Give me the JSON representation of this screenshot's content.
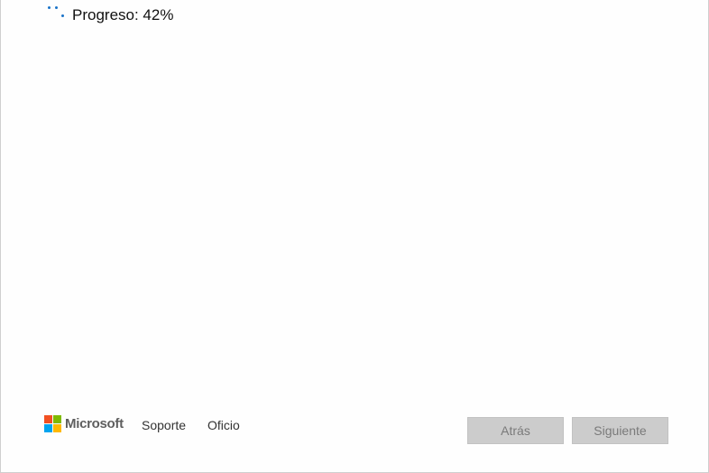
{
  "progress": {
    "label": "Progreso: 42%",
    "value": 0.42,
    "spinner_icon": "loading-spinner-icon"
  },
  "footer": {
    "brand": {
      "name": "Microsoft",
      "icon": "microsoft-logo-icon",
      "colors": [
        "#f25022",
        "#7fba00",
        "#00a4ef",
        "#ffb900"
      ]
    },
    "links": {
      "support": "Soporte",
      "legal": "Oficio"
    },
    "buttons": {
      "back": "Atrás",
      "next": "Siguiente",
      "back_enabled": false,
      "next_enabled": false
    }
  },
  "colors": {
    "accent": "#1a73c8",
    "button_disabled_bg": "#cccccc",
    "button_disabled_text": "#7a7a7a"
  }
}
